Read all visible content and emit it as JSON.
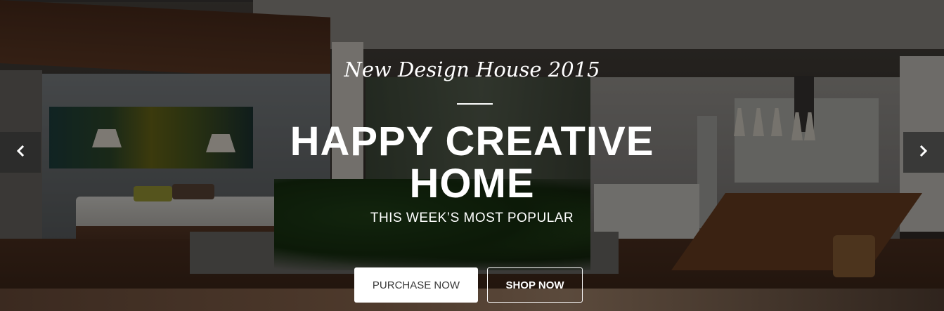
{
  "slider": {
    "subtitle": "New Design House 2015",
    "title_line1": "HAPPY CREATIVE",
    "title_line2": "HOME",
    "tagline": "THIS WEEK’S MOST POPULAR",
    "buttons": {
      "purchase_label": "PURCHASE NOW",
      "shop_label": "SHOP NOW"
    },
    "nav": {
      "prev_icon": "chevron-left-icon",
      "next_icon": "chevron-right-icon"
    }
  },
  "colors": {
    "text": "#ffffff",
    "overlay": "rgba(0,0,0,0.45)",
    "nav_background": "#282828",
    "primary_button_bg": "#ffffff",
    "primary_button_text": "#3a3a3a"
  }
}
